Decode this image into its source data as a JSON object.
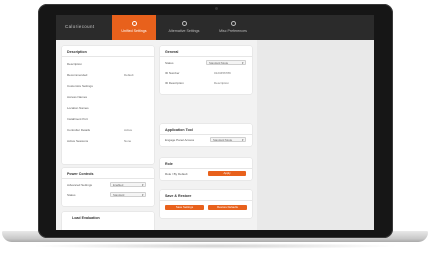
{
  "app": {
    "brand": "Caloriecount",
    "tabs": [
      {
        "label": "Unified Settings",
        "active": true
      },
      {
        "label": "Alternative Settings",
        "active": false
      },
      {
        "label": "Misc Preferences",
        "active": false
      }
    ]
  },
  "general_card": {
    "title": "Description",
    "rows": [
      {
        "label": "Description",
        "value": ""
      },
      {
        "label": "Recommended",
        "value": "Default"
      },
      {
        "label": "Customize Settings",
        "value": ""
      },
      {
        "label": "Access Names",
        "value": ""
      },
      {
        "label": "Location Names",
        "value": ""
      },
      {
        "label": "Installment Port",
        "value": ""
      },
      {
        "label": "Controller Details",
        "value": "Active"
      },
      {
        "label": "Active Sessions",
        "value": "None"
      }
    ]
  },
  "power_card": {
    "title": "Power Controls",
    "rows": [
      {
        "label": "Advanced Settings",
        "value": "Enabled"
      },
      {
        "label": "Status",
        "value": "Standard"
      }
    ]
  },
  "load_card": {
    "title": "Load Evaluation"
  },
  "general2_card": {
    "title": "General",
    "rows": [
      {
        "label": "Status",
        "value": "Standard Mode"
      },
      {
        "label": "ID Number",
        "value": "0123456789"
      },
      {
        "label": "ID Description",
        "value": "Description"
      }
    ]
  },
  "application_card": {
    "title": "Application Tool",
    "rows": [
      {
        "label": "Engage Panel Access",
        "value": "Standard Mode"
      }
    ]
  },
  "role_card": {
    "title": "Role",
    "rows": [
      {
        "label": "Role / By Default",
        "button": "Apply"
      }
    ]
  },
  "reset_card": {
    "title": "Save & Restore",
    "buttons": [
      "Save Settings",
      "Restore Defaults"
    ]
  },
  "colors": {
    "accent": "#e8611c",
    "header": "#2b2b2b"
  }
}
